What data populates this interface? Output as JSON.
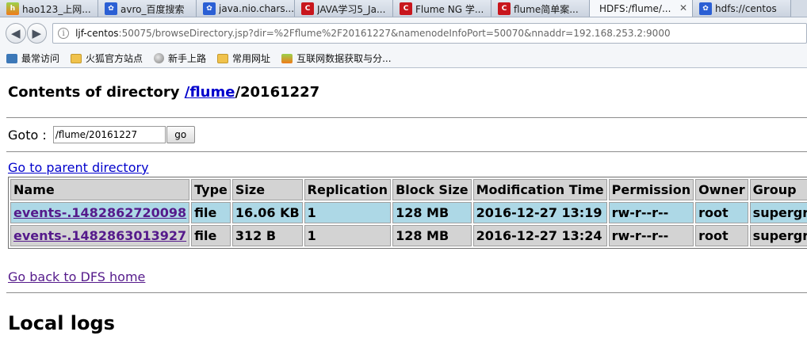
{
  "browser": {
    "tabs": [
      {
        "label": "hao123_上网...",
        "icon": "hao123-icon"
      },
      {
        "label": "avro_百度搜索",
        "icon": "baidu-paw-icon"
      },
      {
        "label": "java.nio.chars...",
        "icon": "baidu-paw-icon"
      },
      {
        "label": "JAVA学习5_Ja...",
        "icon": "csdn-c-icon"
      },
      {
        "label": "Flume NG 学...",
        "icon": "csdn-c-icon"
      },
      {
        "label": "flume简单案...",
        "icon": "csdn-c-icon"
      },
      {
        "label": "HDFS:/flume/...",
        "icon": "none",
        "active": true
      },
      {
        "label": "hdfs://centos",
        "icon": "baidu-paw-icon"
      }
    ],
    "url_host": "ljf-centos",
    "url_rest": ":50075/browseDirectory.jsp?dir=%2Fflume%2F20161227&namenodeInfoPort=50070&nnaddr=192.168.253.2:9000",
    "bookmarks": [
      {
        "label": "最常访问",
        "icon": "gear-icon"
      },
      {
        "label": "火狐官方站点",
        "icon": "folder-icon"
      },
      {
        "label": "新手上路",
        "icon": "globe-icon"
      },
      {
        "label": "常用网址",
        "icon": "folder-icon"
      },
      {
        "label": "互联网数据获取与分...",
        "icon": "hao123-icon"
      }
    ]
  },
  "page": {
    "title_prefix": "Contents of directory ",
    "title_link_slash": "/",
    "title_link_dir": "flume",
    "title_suffix": "/20161227",
    "goto_label": "Goto :",
    "goto_value": "/flume/20161227",
    "goto_button": "go",
    "parent_link": "Go to parent directory",
    "table": {
      "headers": [
        "Name",
        "Type",
        "Size",
        "Replication",
        "Block Size",
        "Modification Time",
        "Permission",
        "Owner",
        "Group"
      ],
      "rows": [
        [
          "events-.1482862720098",
          "file",
          "16.06 KB",
          "1",
          "128 MB",
          "2016-12-27 13:19",
          "rw-r--r--",
          "root",
          "supergroup"
        ],
        [
          "events-.1482863013927",
          "file",
          "312 B",
          "1",
          "128 MB",
          "2016-12-27 13:24",
          "rw-r--r--",
          "root",
          "supergroup"
        ]
      ]
    },
    "home_link": "Go back to DFS home",
    "logs_heading": "Local logs"
  }
}
